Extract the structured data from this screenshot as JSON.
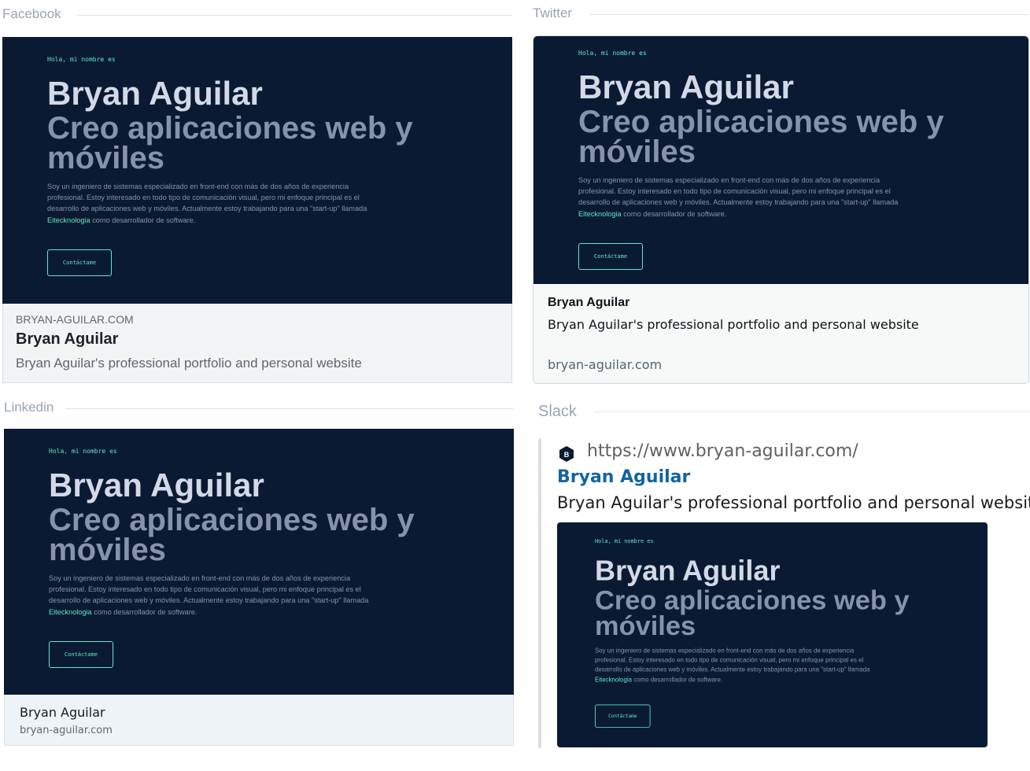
{
  "sections": {
    "facebook": "Facebook",
    "twitter": "Twitter",
    "linkedin": "Linkedin",
    "slack": "Slack"
  },
  "hero": {
    "greeting": "Hola, mi nombre es",
    "name": "Bryan Aguilar",
    "tagline": "Creo aplicaciones web y móviles",
    "desc_before": "Soy un ingeniero de sistemas especializado en front-end con más de dos años de experiencia profesional. Estoy interesado en todo tipo de comunicación visual, pero mi enfoque principal es el desarrollo de aplicaciones web y móviles. Actualmente estoy trabajando para una \"start-up\" llamada ",
    "desc_highlight": "Eitecknologia",
    "desc_after": " como desarrollador de software.",
    "contact_button": "Contáctame"
  },
  "facebook": {
    "domain": "BRYAN-AGUILAR.COM",
    "title": "Bryan Aguilar",
    "description": "Bryan Aguilar's professional portfolio and personal website"
  },
  "twitter": {
    "title": "Bryan Aguilar",
    "description": "Bryan Aguilar's professional portfolio and personal website",
    "domain": "bryan-aguilar.com"
  },
  "linkedin": {
    "title": "Bryan Aguilar",
    "domain": "bryan-aguilar.com"
  },
  "slack": {
    "favicon_letter": "B",
    "url": "https://www.bryan-aguilar.com/",
    "title": "Bryan Aguilar",
    "description": "Bryan Aguilar's professional portfolio and personal website"
  },
  "colors": {
    "hero_bg": "#0b1a33",
    "accent": "#5ee8c7",
    "slack_link": "#1264a3"
  }
}
